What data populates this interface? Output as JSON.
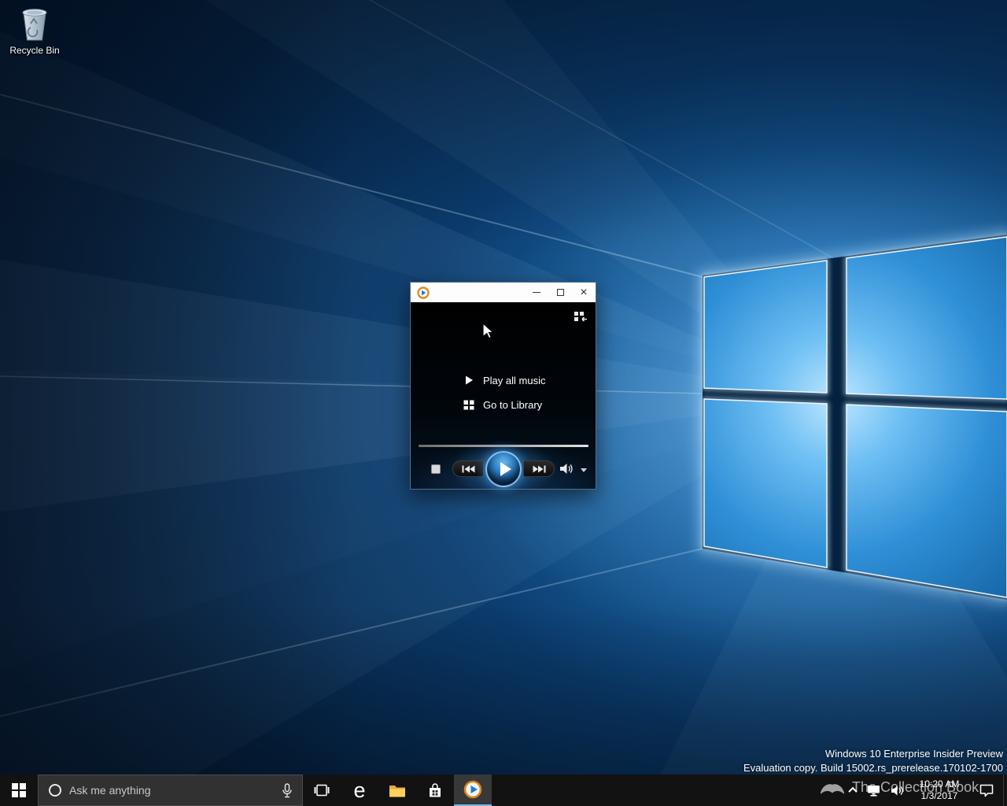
{
  "desktop": {
    "recycle_bin_label": "Recycle Bin",
    "watermark": {
      "line1": "Windows 10 Enterprise Insider Preview",
      "line2": "Evaluation copy. Build 15002.rs_prerelease.170102-1700"
    },
    "collection_watermark": "The Collection Book"
  },
  "wmp_window": {
    "menu": {
      "play_all_label": "Play all music",
      "go_to_library_label": "Go to Library"
    }
  },
  "taskbar": {
    "search": {
      "placeholder": "Ask me anything"
    },
    "clock": {
      "time": "10:20 AM",
      "date": "1/3/2017"
    }
  },
  "icons": {
    "edge_glyph": "e",
    "close_glyph": "×",
    "minimize": "horizontal-bar-css-shape",
    "maximize": "outline-square-css-shape",
    "start": "windows-logo-four-squares",
    "play": "white-triangle",
    "library_grid": "four-white-squares",
    "volume": "speaker-with-waves"
  },
  "colors": {
    "accent": "#2f8fd6",
    "taskbar_bg": "#121212",
    "wmp_titlebar": "#fdfdfd",
    "pane_blue": "#4fa8e8"
  }
}
